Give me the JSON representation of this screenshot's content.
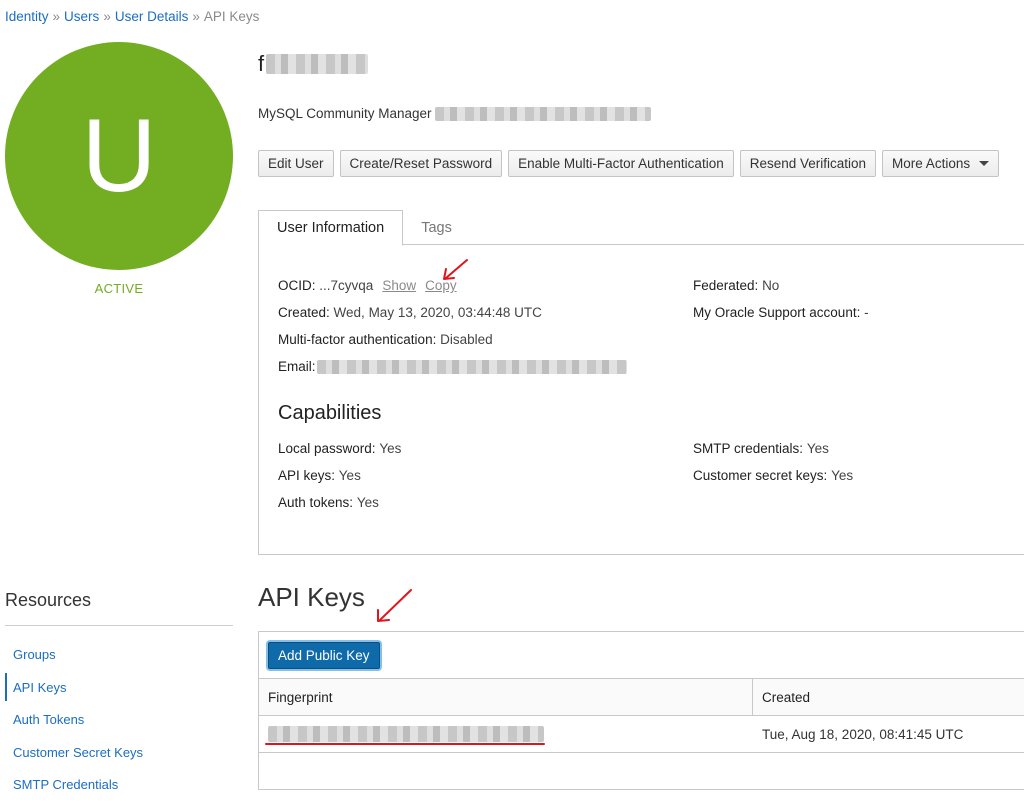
{
  "breadcrumb": {
    "items": [
      "Identity",
      "Users",
      "User Details"
    ],
    "separator": "»",
    "current": "API Keys"
  },
  "user": {
    "avatar_letter": "U",
    "status": "ACTIVE",
    "name_initial": "f",
    "description": "MySQL Community Manager"
  },
  "actions": {
    "edit_user": "Edit User",
    "create_reset_password": "Create/Reset Password",
    "enable_mfa": "Enable Multi-Factor Authentication",
    "resend_verification": "Resend Verification",
    "more_actions": "More Actions"
  },
  "tabs": {
    "user_information": "User Information",
    "tags": "Tags"
  },
  "user_info": {
    "ocid_label": "OCID:",
    "ocid_value": "...7cyvqa",
    "ocid_show": "Show",
    "ocid_copy": "Copy",
    "created_label": "Created:",
    "created_value": "Wed, May 13, 2020, 03:44:48 UTC",
    "mfa_label": "Multi-factor authentication:",
    "mfa_value": "Disabled",
    "email_label": "Email:",
    "federated_label": "Federated:",
    "federated_value": "No",
    "support_label": "My Oracle Support account:",
    "support_value": "-"
  },
  "capabilities": {
    "title": "Capabilities",
    "local_password_label": "Local password:",
    "local_password_value": "Yes",
    "api_keys_label": "API keys:",
    "api_keys_value": "Yes",
    "auth_tokens_label": "Auth tokens:",
    "auth_tokens_value": "Yes",
    "smtp_label": "SMTP credentials:",
    "smtp_value": "Yes",
    "customer_secret_label": "Customer secret keys:",
    "customer_secret_value": "Yes"
  },
  "resources": {
    "title": "Resources",
    "items": [
      "Groups",
      "API Keys",
      "Auth Tokens",
      "Customer Secret Keys",
      "SMTP Credentials"
    ],
    "active": "API Keys"
  },
  "api_keys": {
    "title": "API Keys",
    "add_button": "Add Public Key",
    "columns": [
      "Fingerprint",
      "Created"
    ],
    "rows": [
      {
        "created": "Tue, Aug 18, 2020, 08:41:45 UTC"
      }
    ]
  },
  "colors": {
    "link": "#1b6ec2",
    "status_green": "#73ad21",
    "primary_button": "#0e6aa8",
    "annotation_red": "#e0151b"
  }
}
